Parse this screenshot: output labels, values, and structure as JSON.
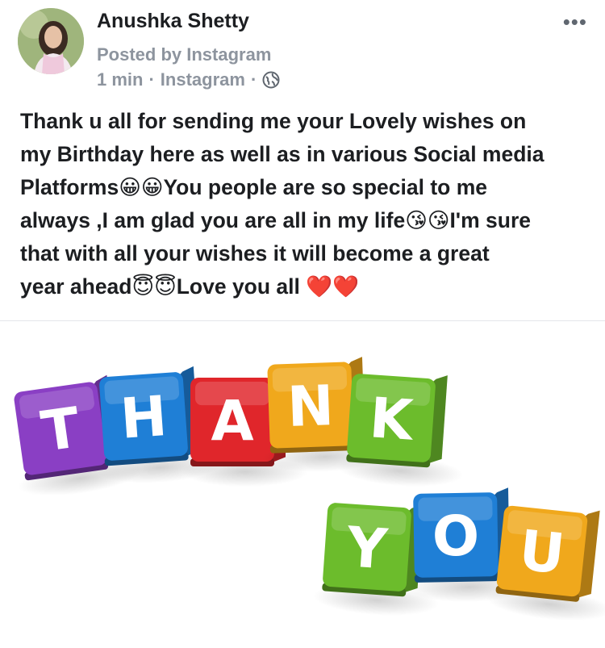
{
  "post": {
    "author": "Anushka Shetty",
    "posted_by": "Posted by Instagram",
    "time": "1 min",
    "separator": "·",
    "source": "Instagram",
    "privacy_icon": "globe-icon",
    "more_icon": "more-options-icon",
    "more_label": "•••",
    "text_lines": [
      "Thank u all for sending me your Lovely wishes on",
      "my Birthday here as well as in various Social media",
      "Platforms😀😀You people are so special to me",
      "always ,I am glad you are all in my life😘😘I'm sure",
      "that with all your wishes it will become a great",
      "year ahead😇😇Love you all ❤️❤️"
    ]
  },
  "image": {
    "top_word_letters": [
      "T",
      "H",
      "A",
      "N",
      "K"
    ],
    "bottom_word_letters": [
      "Y",
      "O",
      "U"
    ],
    "colors": {
      "purple": "#8a3fc4",
      "blue": "#1f7fd6",
      "red": "#e0262b",
      "orange": "#f0a81c",
      "green": "#6cbc2c"
    }
  }
}
